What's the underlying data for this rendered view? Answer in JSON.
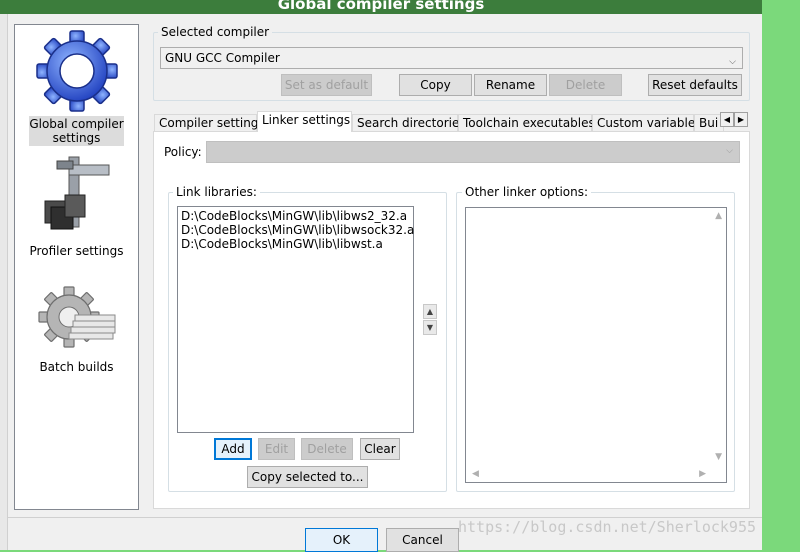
{
  "window": {
    "title": "Global compiler settings"
  },
  "sidebar": {
    "items": [
      {
        "label": "Global compiler settings",
        "icon": "gear-icon",
        "selected": true
      },
      {
        "label": "Profiler settings",
        "icon": "caliper-icon",
        "selected": false
      },
      {
        "label": "Batch builds",
        "icon": "gear-stack-icon",
        "selected": false
      }
    ]
  },
  "compiler": {
    "section_label": "Selected compiler",
    "selected_value": "GNU GCC Compiler",
    "buttons": {
      "set_default": "Set as default",
      "copy": "Copy",
      "rename": "Rename",
      "delete": "Delete",
      "reset": "Reset defaults"
    }
  },
  "tabs": [
    {
      "label": "Compiler settings",
      "active": false
    },
    {
      "label": "Linker settings",
      "active": true
    },
    {
      "label": "Search directories",
      "active": false
    },
    {
      "label": "Toolchain executables",
      "active": false
    },
    {
      "label": "Custom variables",
      "active": false
    },
    {
      "label": "Bui",
      "active": false
    }
  ],
  "linker": {
    "policy_label": "Policy:",
    "policy_value": "",
    "link_libraries_label": "Link libraries:",
    "libraries": [
      "D:\\CodeBlocks\\MinGW\\lib\\libws2_32.a",
      "D:\\CodeBlocks\\MinGW\\lib\\libwsock32.a",
      "D:\\CodeBlocks\\MinGW\\lib\\libwst.a"
    ],
    "buttons": {
      "add": "Add",
      "edit": "Edit",
      "delete": "Delete",
      "clear": "Clear",
      "copy_selected": "Copy selected to..."
    },
    "other_options_label": "Other linker options:",
    "other_options_value": ""
  },
  "dialog": {
    "ok": "OK",
    "cancel": "Cancel"
  },
  "watermark": "https://blog.csdn.net/Sherlock955",
  "colors": {
    "accent": "#0078d7",
    "background": "#f0f0f0",
    "desktop": "#7bd97b"
  }
}
